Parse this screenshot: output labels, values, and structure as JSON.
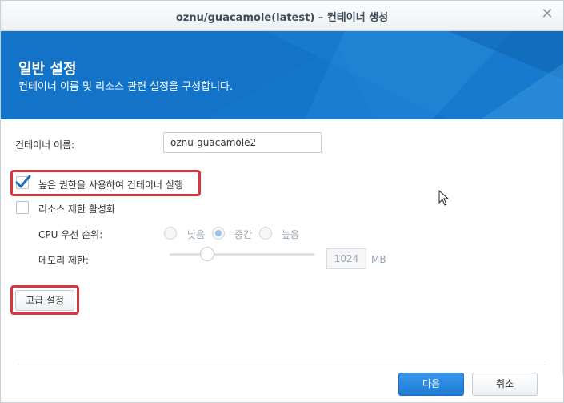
{
  "dialog": {
    "title": "oznu/guacamole(latest) – 컨테이너 생성",
    "close_glyph": "✕"
  },
  "banner": {
    "title": "일반 설정",
    "subtitle": "컨테이너 이름 및 리소스 관련 설정을 구성합니다."
  },
  "form": {
    "container_name_label": "컨테이너 이름:",
    "container_name_value": "oznu-guacamole2",
    "privileged_label": "높은 권한을 사용하여 컨테이너 실행",
    "privileged_checked": true,
    "resource_limit_label": "리소스 제한 활성화",
    "resource_limit_checked": false,
    "cpu_priority_label": "CPU 우선 순위:",
    "cpu_options": [
      "낮음",
      "중간",
      "높음"
    ],
    "cpu_selected": "중간",
    "memory_limit_label": "메모리 제한:",
    "memory_value": "1024",
    "memory_unit": "MB"
  },
  "buttons": {
    "advanced": "고급 설정",
    "next": "다음",
    "cancel": "취소"
  },
  "colors": {
    "accent": "#1273c8",
    "highlight": "#d9363e",
    "check": "#1d6fc1"
  }
}
